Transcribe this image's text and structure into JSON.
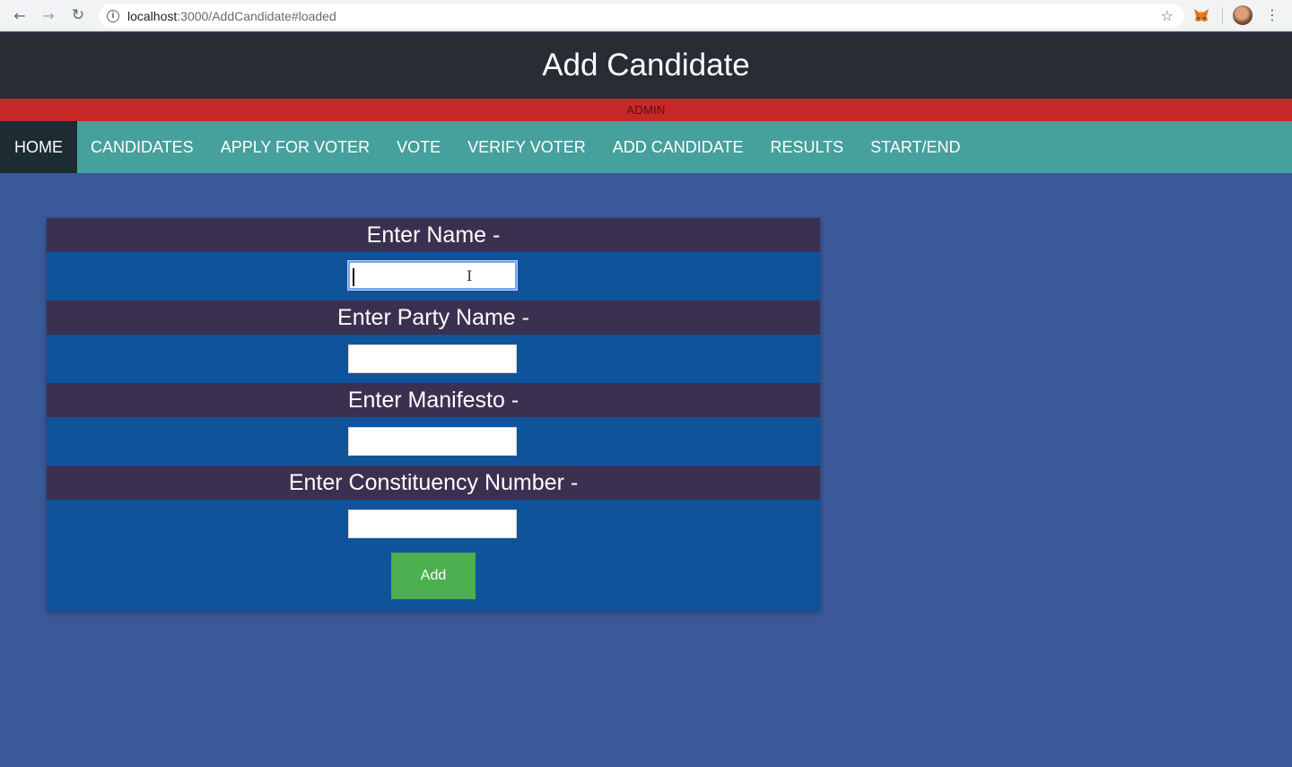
{
  "browser": {
    "url_host": "localhost",
    "url_rest": ":3000/AddCandidate#loaded"
  },
  "header": {
    "title": "Add Candidate",
    "role_banner": "ADMIN"
  },
  "nav": {
    "items": [
      {
        "label": "HOME",
        "active": true
      },
      {
        "label": "CANDIDATES"
      },
      {
        "label": "APPLY FOR VOTER"
      },
      {
        "label": "VOTE"
      },
      {
        "label": "VERIFY VOTER"
      },
      {
        "label": "ADD CANDIDATE"
      },
      {
        "label": "RESULTS"
      },
      {
        "label": "START/END"
      }
    ]
  },
  "form": {
    "name_label": "Enter Name -",
    "name_value": "",
    "party_label": "Enter Party Name -",
    "party_value": "",
    "manifesto_label": "Enter Manifesto -",
    "manifesto_value": "",
    "constituency_label": "Enter Constituency Number -",
    "constituency_value": "",
    "submit_label": "Add"
  },
  "colors": {
    "header_bg": "#282c34",
    "admin_bar": "#c62828",
    "navbar": "#46a09c",
    "page_bg": "#3b5998",
    "form_bg": "#0f539a",
    "label_bg": "#3a3150",
    "button": "#4caf50"
  },
  "icons": {
    "back": "arrow-left-icon",
    "forward": "arrow-right-icon",
    "reload": "reload-icon",
    "info": "info-icon",
    "bookmark": "star-icon",
    "extension": "metamask-fox-icon",
    "menu": "kebab-menu-icon"
  }
}
